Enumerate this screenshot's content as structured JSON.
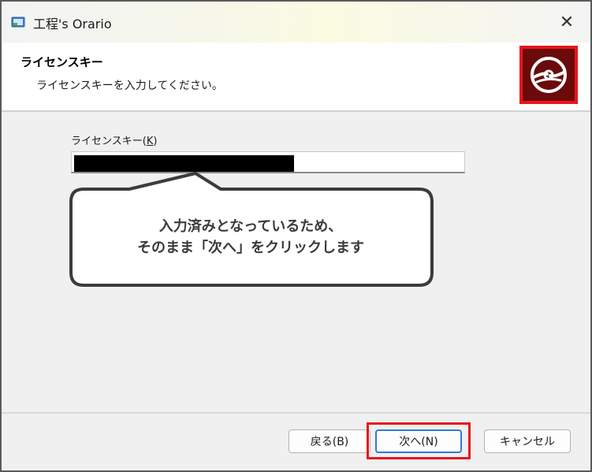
{
  "window": {
    "title": "工程's Orario",
    "close_symbol": "✕"
  },
  "header": {
    "title": "ライセンスキー",
    "subtitle": "ライセンスキーを入力してください。"
  },
  "form": {
    "label_text": "ライセンスキー(",
    "label_mnemonic": "K",
    "label_close": ")",
    "license_value_masked": true
  },
  "callout": {
    "line1": "入力済みとなっているため、",
    "line2": "そのまま「次へ」をクリックします"
  },
  "buttons": {
    "back_label": "戻る(B)",
    "next_label": "次へ(N)",
    "cancel_label": "キャンセル"
  },
  "colors": {
    "highlight": "#e8151b",
    "logo_bg": "#6b0a0a",
    "focus": "#2f7bd6"
  }
}
